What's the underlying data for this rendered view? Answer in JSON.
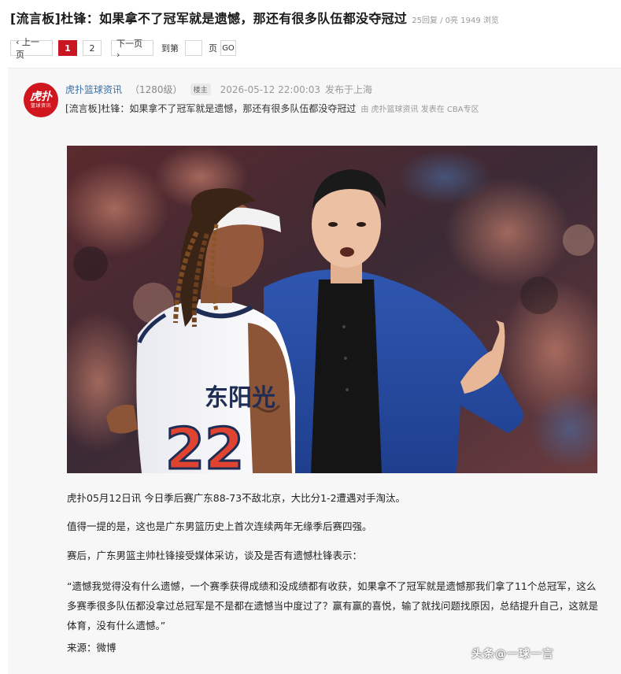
{
  "thread": {
    "title": "[流言板]杜锋：如果拿不了冠军就是遗憾，那还有很多队伍都没夺冠过",
    "stats": "25回复 / 0亮 1949 浏览"
  },
  "pager": {
    "prev_label": "‹ 上一页",
    "pages": [
      "1",
      "2"
    ],
    "next_label": "下一页 ›",
    "goto_label": "到第",
    "page_unit": "页",
    "go_label": "GO"
  },
  "post": {
    "avatar_text_main": "虎扑",
    "avatar_text_sub": "篮球资讯",
    "author": "虎扑篮球资讯",
    "level": "（1280级）",
    "badge": "楼主",
    "time": "2026-05-12 22:00:03",
    "location": "发布于上海",
    "subtitle": "[流言板]杜锋：如果拿不了冠军就是遗憾，那还有很多队伍都没夺冠过",
    "from": "由 虎扑篮球资讯 发表在 CBA专区",
    "image": {
      "jersey_text": "东阳光",
      "jersey_number": "22"
    },
    "paragraphs": [
      "虎扑05月12日讯 今日季后赛广东88-73不敌北京，大比分1-2遭遇对手淘汰。",
      "值得一提的是，这也是广东男篮历史上首次连续两年无缘季后赛四强。",
      "赛后，广东男篮主帅杜锋接受媒体采访，谈及是否有遗憾杜锋表示：",
      "“遗憾我觉得没有什么遗憾，一个赛季获得成绩和没成绩都有收获，如果拿不了冠军就是遗憾那我们拿了11个总冠军，这么多赛季很多队伍都没拿过总冠军是不是都在遗憾当中度过了？赢有赢的喜悦，输了就找问题找原因，总结提升自己，这就是体育，没有什么遗憾。”",
      "来源：微博"
    ],
    "watermark": "头条@一球一言"
  }
}
